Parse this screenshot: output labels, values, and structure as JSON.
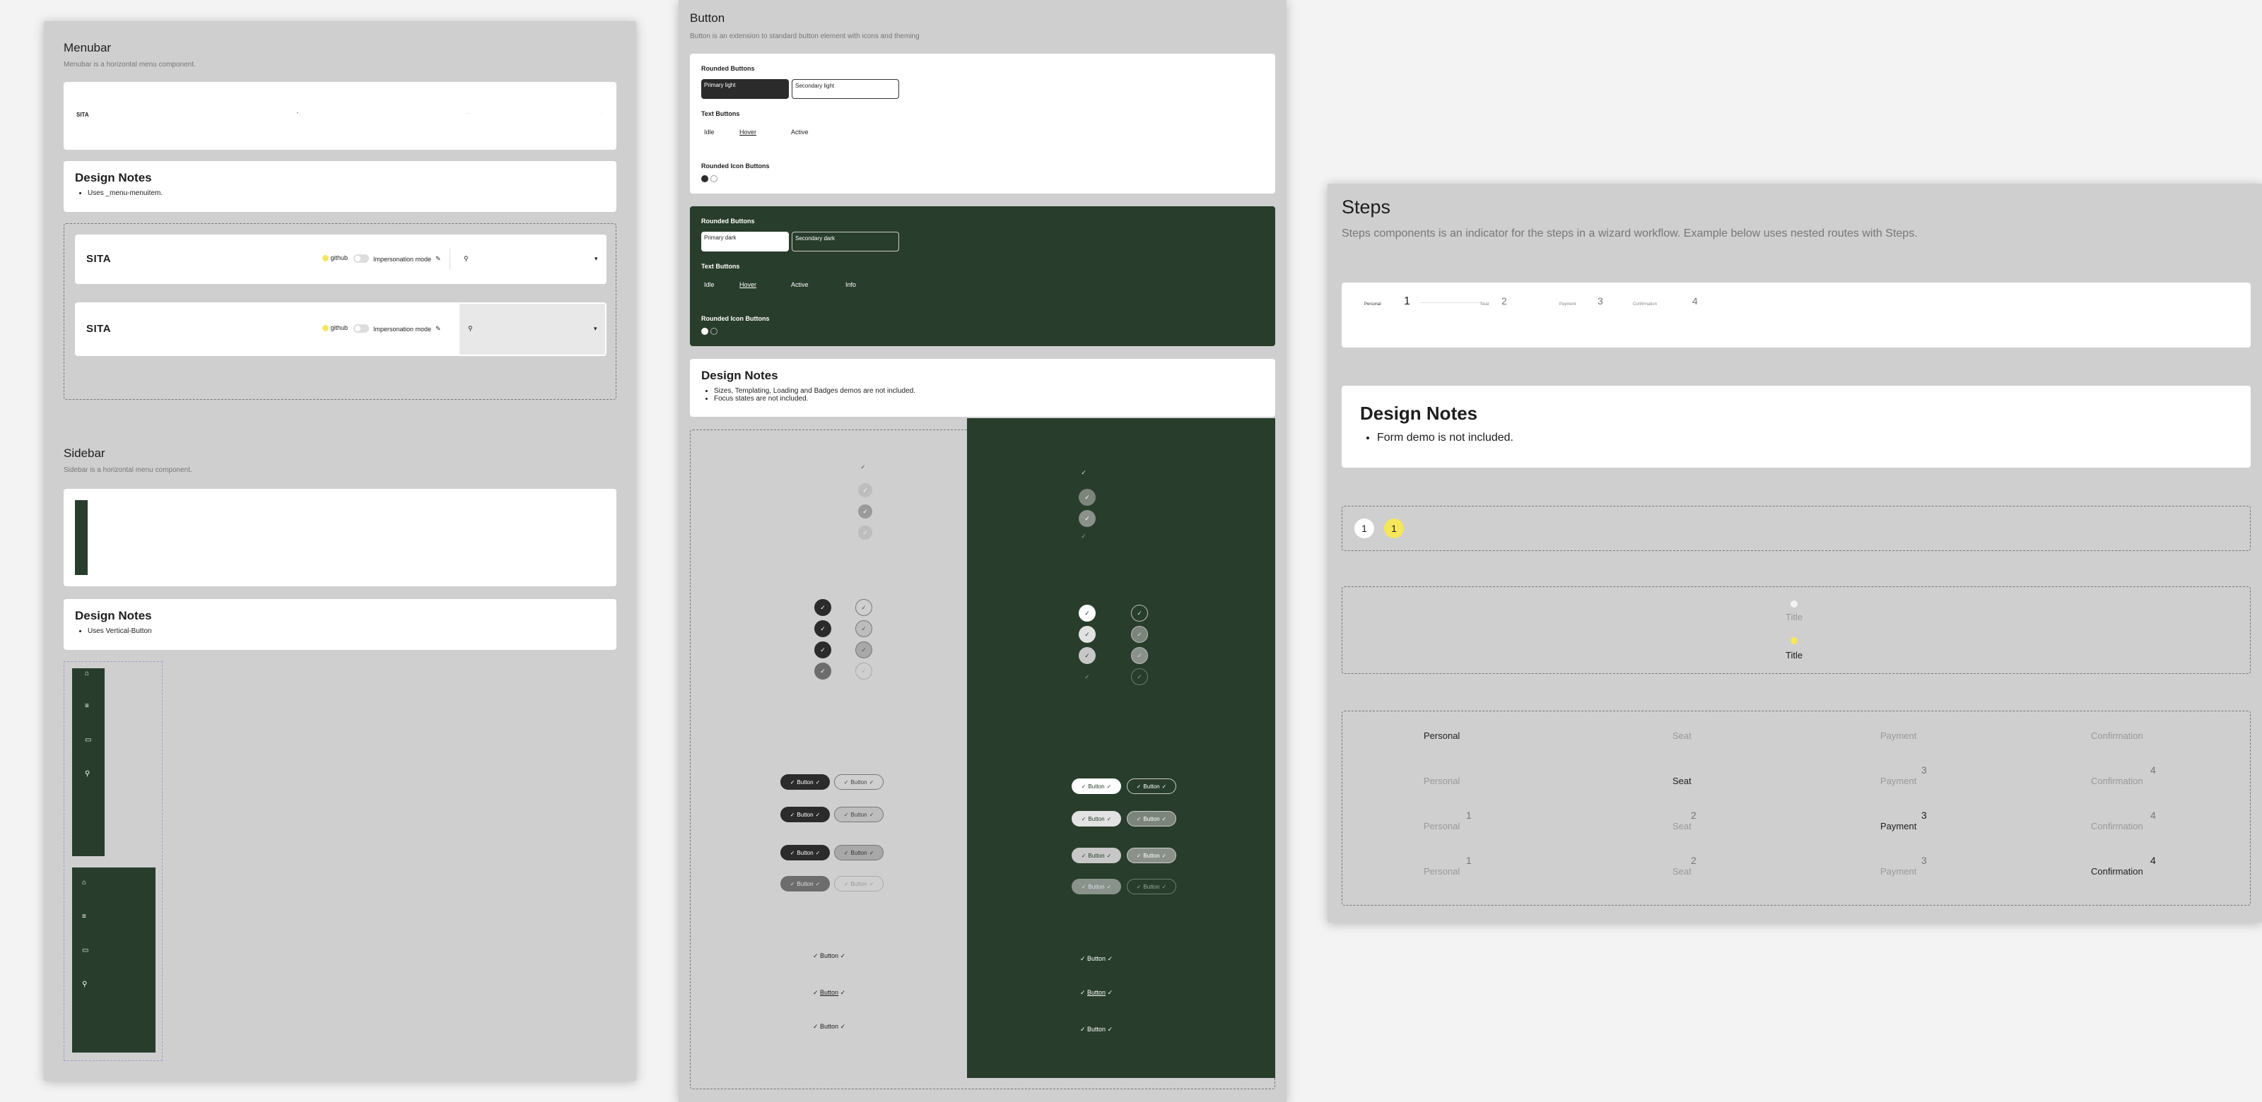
{
  "menubar": {
    "title": "Menubar",
    "subtitle": "Menubar is a horizontal menu component.",
    "logo": "SITA",
    "github_label": "github",
    "impersonation_label": "Impersonation mode",
    "design_notes_title": "Design Notes",
    "design_notes": [
      "Uses _menu-menuitem."
    ]
  },
  "sidebar": {
    "title": "Sidebar",
    "subtitle": "Sidebar is a horizontal menu component.",
    "design_notes_title": "Design Notes",
    "design_notes": [
      "Uses Vertical-Button"
    ],
    "icons": [
      "home-icon",
      "list-icon",
      "folder-icon",
      "search-icon"
    ]
  },
  "button": {
    "title": "Button",
    "subtitle": "Button is an extension to standard button element with icons and theming",
    "light": {
      "rounded_title": "Rounded Buttons",
      "primary": "Primary light",
      "secondary": "Secondary light",
      "text_title": "Text Buttons",
      "text_buttons": [
        "Idle",
        "Hover",
        "Active"
      ],
      "icon_title": "Rounded Icon Buttons"
    },
    "dark": {
      "rounded_title": "Rounded Buttons",
      "primary": "Primary dark",
      "secondary": "Secondary dark",
      "text_title": "Text Buttons",
      "text_buttons": [
        "Idle",
        "Hover",
        "Active",
        "Info"
      ],
      "icon_title": "Rounded Icon Buttons"
    },
    "design_notes_title": "Design Notes",
    "design_notes": [
      "Sizes, Templating, Loading and Badges demos are not included.",
      "Focus states are not included."
    ],
    "pill_label": "Button",
    "text_label": "Button",
    "check": "✓"
  },
  "steps": {
    "title": "Steps",
    "subtitle": "Steps components is an indicator for the steps in a wizard workflow. Example below uses nested routes with Steps.",
    "top_labels": [
      "Personal",
      "Seat",
      "Payment",
      "Confirmation"
    ],
    "numbers": [
      "1",
      "2",
      "3",
      "4"
    ],
    "design_notes_title": "Design Notes",
    "design_notes": [
      "Form demo is not included."
    ],
    "badge_numbers": [
      "1",
      "1"
    ],
    "vertical_title": "Title",
    "grid_labels": [
      "Personal",
      "Seat",
      "Payment",
      "Confirmation"
    ]
  },
  "colors": {
    "frame": "#cfcfcf",
    "dark_green": "#283d2b",
    "accent_yellow": "#f5e65c",
    "primary_dark": "#2b2b2b"
  }
}
